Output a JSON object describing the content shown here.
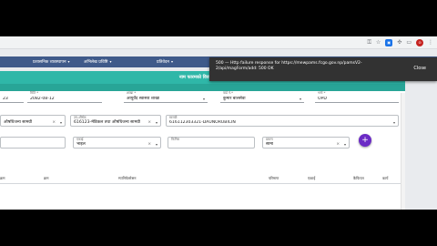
{
  "browser": {
    "ext_icon": "extension-badge",
    "profile_initial": "⊙"
  },
  "nav": {
    "items": [
      {
        "label": "प्रशासनिक व्यवस्थापन"
      },
      {
        "label": "अभिलेख प्रविष्टि"
      },
      {
        "label": "प्रतिवेदन"
      }
    ]
  },
  "panel": {
    "title": "नाम फारमको विवरण प्रविष्टि"
  },
  "form": {
    "row1": [
      {
        "label": "",
        "value": "23"
      },
      {
        "label": "मिति *",
        "value": "2082-08-12"
      },
      {
        "label": "शाखा *",
        "value": "आयुर्वेद स्वास्थ्य शाखा"
      },
      {
        "label": "वार्ड नं.*",
        "value": "कुमार बालसेवा"
      },
      {
        "label": "भर्ना *",
        "value": "OPD"
      }
    ],
    "row2": [
      {
        "label": "",
        "value": "औषधिजन्य सामग्री"
      },
      {
        "label": "उप-शीर्षक",
        "value": "616123-मेडिकल तथा औषधिजन्य सामग्री"
      },
      {
        "label": "सामग्री",
        "value": "616112303321-DAUNORUBICIN"
      }
    ],
    "row3": [
      {
        "label": "",
        "value": ""
      },
      {
        "label": "एकाई",
        "value": "भाइल"
      },
      {
        "label": "फिनिस",
        "value": ""
      },
      {
        "label": "प्रमाण",
        "value": "सामा"
      }
    ],
    "add_symbol": "+"
  },
  "table": {
    "headers": [
      "क्रम",
      "क्रम",
      "म्यानिफेस्टेसन",
      "परिमाण",
      "एकाई",
      "कैफियत",
      "कार्य"
    ]
  },
  "toast": {
    "message": "500 — Http failure response for https://mewpams.fcgo.gov.np/pamsV2-2/api/magForm/add: 500 OK",
    "close_label": "Close"
  }
}
